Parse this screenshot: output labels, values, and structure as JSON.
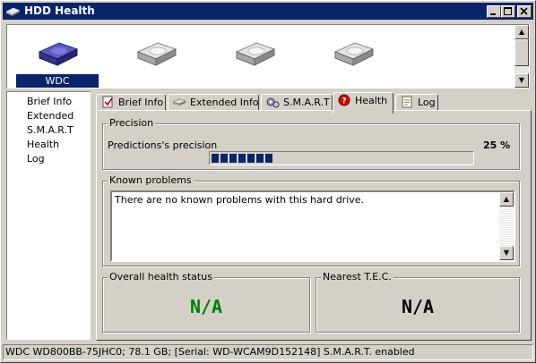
{
  "window": {
    "title": "HDD Health"
  },
  "drives": [
    {
      "label": "WDC",
      "selected": true
    },
    {
      "label": "",
      "selected": false
    },
    {
      "label": "",
      "selected": false
    },
    {
      "label": "",
      "selected": false
    }
  ],
  "nav": {
    "items": [
      "Brief Info",
      "Extended",
      "S.M.A.R.T",
      "Health",
      "Log"
    ]
  },
  "tabs": [
    {
      "label": "Brief Info",
      "icon": "document-check-icon"
    },
    {
      "label": "Extended Info",
      "icon": "hard-drive-icon"
    },
    {
      "label": "S.M.A.R.T",
      "icon": "gears-icon"
    },
    {
      "label": "Health",
      "icon": "health-question-icon",
      "active": true
    },
    {
      "label": "Log",
      "icon": "notepad-icon"
    }
  ],
  "health": {
    "precision": {
      "legend": "Precision",
      "label": "Predictions's precision",
      "value_text": "25 %",
      "value_fraction": 0.25
    },
    "known_problems": {
      "legend": "Known problems",
      "text": "There are no known problems with this hard drive."
    },
    "overall": {
      "legend": "Overall health status",
      "value": "N/A",
      "color": "#008000"
    },
    "tec": {
      "legend": "Nearest T.E.C.",
      "value": "N/A",
      "color": "#000000"
    }
  },
  "statusbar": {
    "text": "WDC WD800BB-75JHC0;   78.1 GB;  [Serial: WD-WCAM9D152148]   S.M.A.R.T. enabled"
  },
  "colors": {
    "titlebar": "#0a246a",
    "selection": "#0a246a",
    "progress": "#0a246a",
    "face": "#d4d0c8"
  }
}
